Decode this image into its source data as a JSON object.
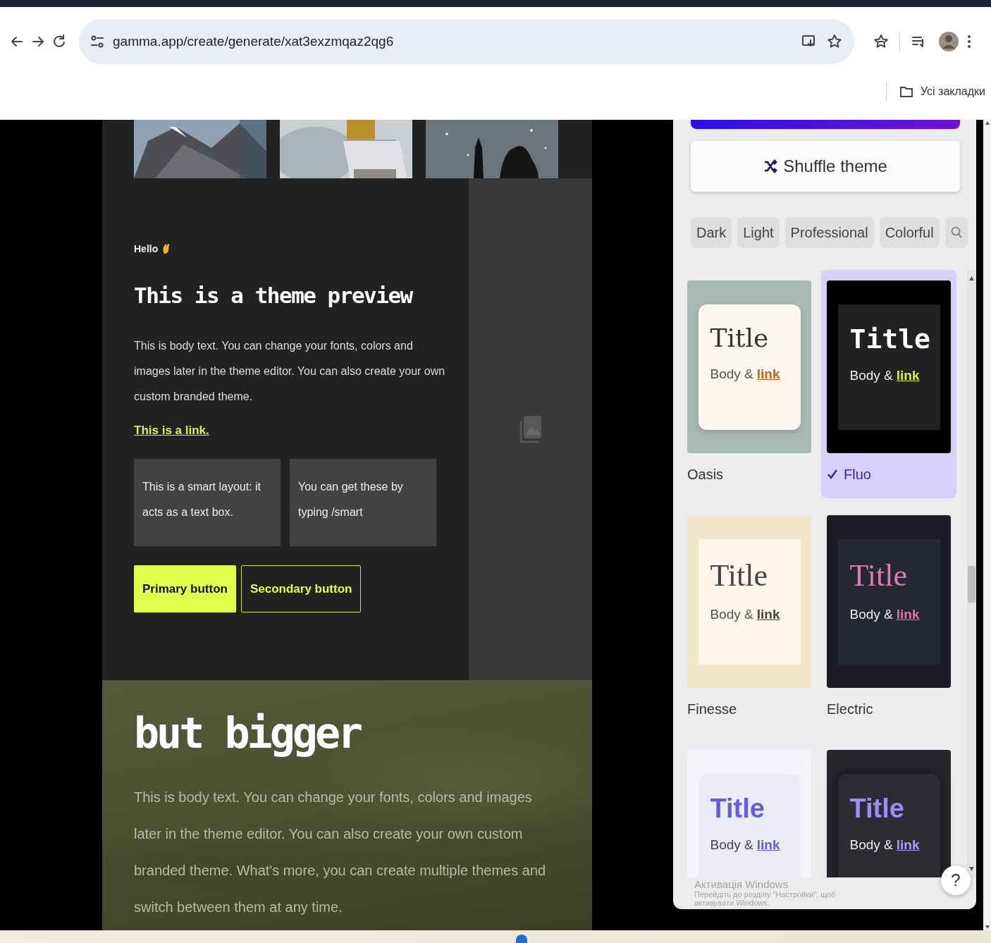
{
  "browser": {
    "url": "gamma.app/create/generate/xat3exzmqaz2qg6",
    "bookmarks_label": "Усі закладки"
  },
  "preview": {
    "photos": [
      {
        "kind": "picture"
      },
      {
        "kind": "picture"
      },
      {
        "kind": "picture"
      }
    ],
    "greeting": "Hello",
    "title": "This is a theme preview",
    "body": "This is body text. You can change your fonts, colors and images later in the theme editor. You can also create your own custom branded theme.",
    "link": "This is a link.",
    "smart_boxes": [
      "This is a smart layout: it acts as a text box.",
      "You can get these by typing /smart"
    ],
    "buttons": [
      {
        "label": "Primary button",
        "kind": "primary"
      },
      {
        "label": "Secondary button",
        "kind": "secondary"
      }
    ],
    "section2": {
      "title": "but bigger",
      "body": "This is body text. You can change your fonts, colors and images later in the theme editor. You can also create your own custom branded theme. What's more, you can create multiple themes and switch between them at any time."
    }
  },
  "theme_panel": {
    "shuffle_button": "Shuffle theme",
    "filters": [
      "Dark",
      "Light",
      "Professional",
      "Colorful"
    ],
    "themes": [
      {
        "name": "Oasis",
        "kind": "oasis",
        "selected": false,
        "title": "Title",
        "body": "Body &",
        "link": "link"
      },
      {
        "name": "Fluo",
        "kind": "fluo",
        "selected": true,
        "title": "Title",
        "body": "Body &",
        "link": "link"
      },
      {
        "name": "Finesse",
        "kind": "finesse",
        "selected": false,
        "title": "Title",
        "body": "Body &",
        "link": "link"
      },
      {
        "name": "Electric",
        "kind": "electric",
        "selected": false,
        "title": "Title",
        "body": "Body &",
        "link": "link"
      },
      {
        "kind": "soft",
        "selected": false,
        "title": "Title",
        "body": "Body &",
        "link": "link"
      },
      {
        "kind": "midnight",
        "selected": false,
        "title": "Title",
        "body": "Body &",
        "link": "link"
      }
    ],
    "help_button": "?"
  },
  "os_notice": {
    "title": "Активація Windows",
    "lines": [
      "Перейдіть до розділу \"Настройки\", щоб",
      "активувати Windows."
    ]
  }
}
